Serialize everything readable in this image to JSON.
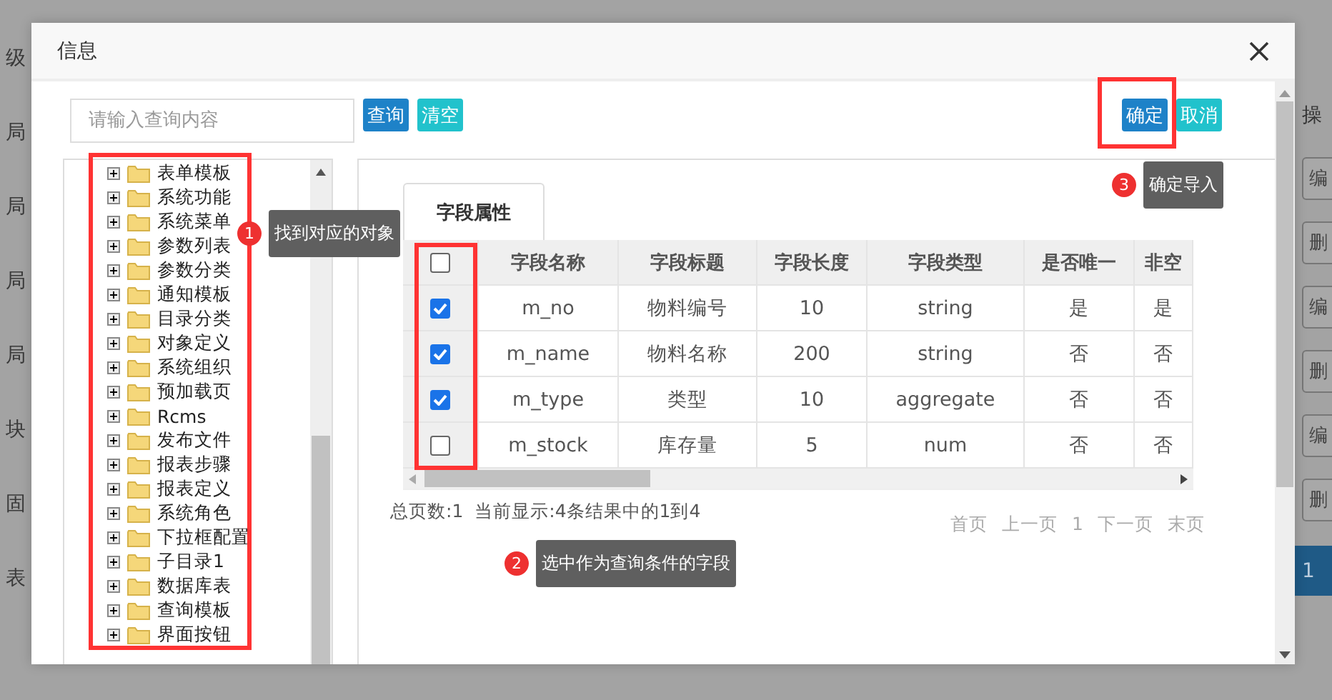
{
  "background": {
    "left_labels": [
      "级",
      "局",
      "局",
      "局",
      "局",
      "块",
      "固",
      "表"
    ],
    "right_header": "操",
    "right_buttons": [
      "编",
      "删",
      "编",
      "删",
      "编",
      "删"
    ],
    "page_number": "1"
  },
  "dialog": {
    "title": "信息",
    "search": {
      "placeholder": "请输入查询内容"
    },
    "search_buttons": [
      {
        "label": "查询",
        "kind": "primary"
      },
      {
        "label": "清空",
        "kind": "info"
      }
    ],
    "action_buttons": [
      {
        "label": "确定",
        "kind": "primary"
      },
      {
        "label": "取消",
        "kind": "info"
      }
    ],
    "tree": {
      "items": [
        {
          "label": "表单模板",
          "expanded": false
        },
        {
          "label": "系统功能",
          "expanded": false
        },
        {
          "label": "系统菜单",
          "expanded": false
        },
        {
          "label": "参数列表",
          "expanded": false
        },
        {
          "label": "参数分类",
          "expanded": false
        },
        {
          "label": "通知模板",
          "expanded": false
        },
        {
          "label": "目录分类",
          "expanded": false
        },
        {
          "label": "对象定义",
          "expanded": false
        },
        {
          "label": "系统组织",
          "expanded": false
        },
        {
          "label": "预加载页",
          "expanded": false
        },
        {
          "label": "Rcms",
          "expanded": false
        },
        {
          "label": "发布文件",
          "expanded": false
        },
        {
          "label": "报表步骤",
          "expanded": false
        },
        {
          "label": "报表定义",
          "expanded": false
        },
        {
          "label": "系统角色",
          "expanded": false
        },
        {
          "label": "下拉框配置",
          "expanded": false
        },
        {
          "label": "子目录1",
          "expanded": false
        },
        {
          "label": "数据库表",
          "expanded": false
        },
        {
          "label": "查询模板",
          "expanded": false
        },
        {
          "label": "界面按钮",
          "expanded": false
        }
      ]
    },
    "tabs": [
      {
        "label": "字段属性",
        "selected": true
      }
    ],
    "table": {
      "header_checked": false,
      "columns": [
        "字段名称",
        "字段标题",
        "字段长度",
        "字段类型",
        "是否唯一",
        "非空"
      ],
      "rows": [
        {
          "checked": true,
          "cells": [
            "m_no",
            "物料编号",
            "10",
            "string",
            "是",
            "是"
          ]
        },
        {
          "checked": true,
          "cells": [
            "m_name",
            "物料名称",
            "200",
            "string",
            "否",
            "否"
          ]
        },
        {
          "checked": true,
          "cells": [
            "m_type",
            "类型",
            "10",
            "aggregate",
            "否",
            "否"
          ]
        },
        {
          "checked": false,
          "cells": [
            "m_stock",
            "库存量",
            "5",
            "num",
            "否",
            "否"
          ]
        }
      ]
    },
    "footer": {
      "summary": "总页数:1  当前显示:4条结果中的1到4",
      "pager": [
        "首页",
        "上一页",
        "1",
        "下一页",
        "末页"
      ]
    },
    "callouts": [
      {
        "number": "1",
        "text": "找到对应的对象"
      },
      {
        "number": "2",
        "text": "选中作为查询条件的字段"
      },
      {
        "number": "3",
        "text": "确定导入"
      }
    ]
  }
}
